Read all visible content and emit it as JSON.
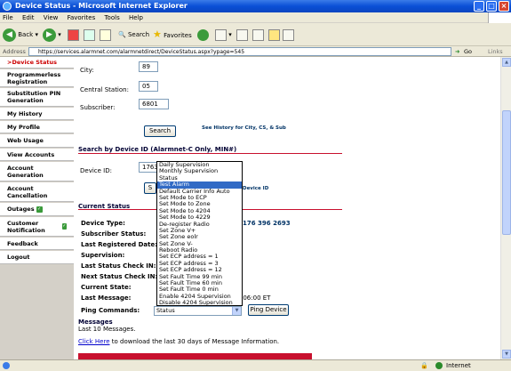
{
  "window": {
    "title": "Device Status - Microsoft Internet Explorer"
  },
  "menu": {
    "items": [
      "File",
      "Edit",
      "View",
      "Favorites",
      "Tools",
      "Help"
    ]
  },
  "toolbar": {
    "back": "Back",
    "search": "Search",
    "favorites": "Favorites"
  },
  "address": {
    "label": "Address",
    "url": "https://services.alarmnet.com/alarmnetdirect/DeviceStatus.aspx?ypage=545",
    "go": "Go",
    "links": "Links"
  },
  "sidebar": {
    "items": [
      {
        "label": ">Device Status"
      },
      {
        "label": "Programmerless Registration"
      },
      {
        "label": "Substitution PIN Generation"
      },
      {
        "label": "My History"
      },
      {
        "label": "My Profile"
      },
      {
        "label": "Web Usage"
      },
      {
        "label": "View Accounts"
      },
      {
        "label": "Account Generation"
      },
      {
        "label": "Account Cancellation"
      },
      {
        "label": "Outages"
      },
      {
        "label": "Customer Notification"
      },
      {
        "label": "Feedback"
      },
      {
        "label": "Logout"
      }
    ]
  },
  "search_by_city": {
    "city_label": "City:",
    "city_value": "89",
    "station_label": "Central Station:",
    "station_value": "05",
    "subscriber_label": "Subscriber:",
    "subscriber_value": "6801",
    "search_button": "Search",
    "history_link": "See History for City, CS, & Sub"
  },
  "search_by_device": {
    "title": "Search by Device ID (Alarmnet-C Only, MIN#)",
    "device_label": "Device ID:",
    "device_value": "1763",
    "button_partial": "S",
    "hint_partial": "Device ID"
  },
  "dropdown": {
    "selected": "Test Alarm",
    "options": [
      "Daily Supervision",
      "Monthly Supervision",
      "Status",
      "Test Alarm",
      "Default Carrier Info Auto",
      "Set Mode to ECP",
      "Set Mode to Zone",
      "Set Mode to 4204",
      "Set Mode to 4229",
      "De-register Radio",
      "Set Zone V+",
      "Set Zone eolr",
      "Set Zone V-",
      "Reboot Radio",
      "Set ECP address = 1",
      "Set ECP address = 3",
      "Set ECP address = 12",
      "Set Fault Time 99 min",
      "Set Fault Time 60 min",
      "Set Fault Time 0 min",
      "Enable 4204 Supervision",
      "Disable 4204 Supervision"
    ]
  },
  "current_status": {
    "title": "Current Status",
    "device_type_label": "Device Type:",
    "device_type_partial": "176 396 2693",
    "subscriber_status_label": "Subscriber Status:",
    "last_registered_label": "Last Registered Date:",
    "supervision_label": "Supervision:",
    "last_status_check_label": "Last Status Check IN:",
    "next_status_check_label": "Next Status Check IN:",
    "current_state_label": "Current State:",
    "last_message_label": "Last Message:",
    "last_message_partial": ":06:00 ET",
    "ping_label": "Ping Commands:",
    "ping_select": "Status",
    "ping_button": "Ping Device"
  },
  "messages": {
    "title": "Messages",
    "subtitle": "Last 10 Messages.",
    "link": "Click Here",
    "link_suffix": "to download the last 30 days of Message Information."
  },
  "status": {
    "zone": "Internet"
  }
}
